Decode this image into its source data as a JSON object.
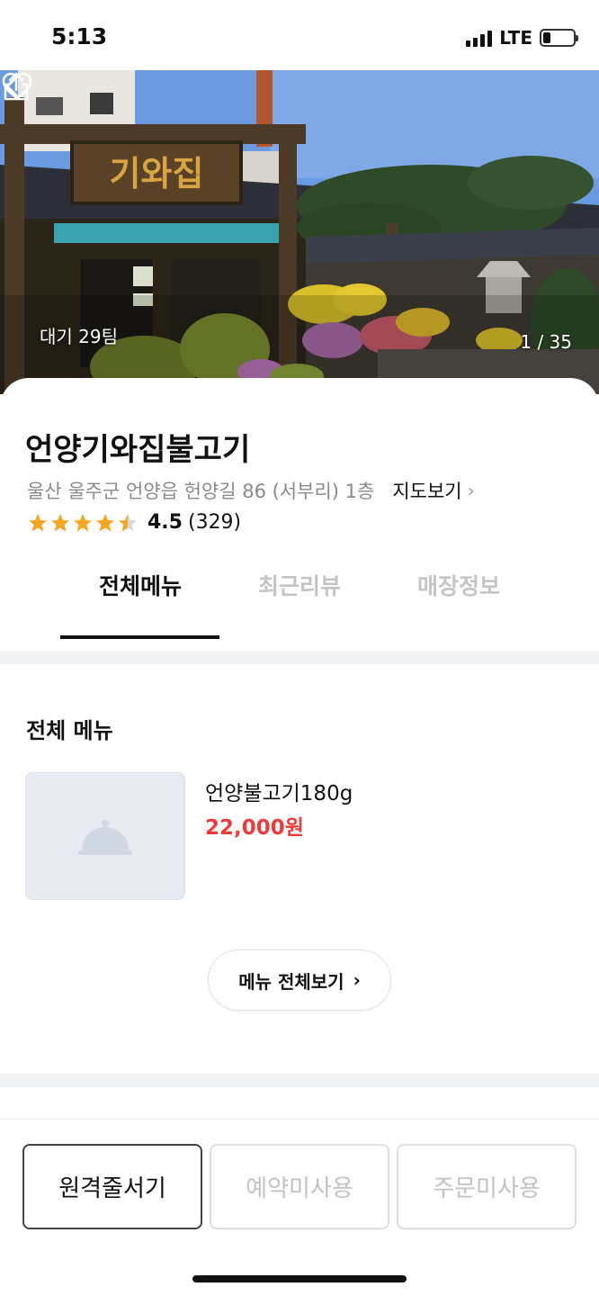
{
  "status_bar": {
    "time": "5:13",
    "network": "LTE"
  },
  "hero": {
    "sign_text": "기와집",
    "wait_label": "대기 29팀",
    "photo_counter": "1 / 35",
    "icons": {
      "back": "chevron-left-icon",
      "share": "share-icon",
      "like": "heart-icon"
    }
  },
  "store": {
    "name": "언양기와집불고기",
    "address": "울산 울주군 언양읍 헌양길 86 (서부리) 1층",
    "map_link": "지도보기",
    "rating": {
      "stars": 4.5,
      "score": "4.5",
      "count": "(329)"
    }
  },
  "tabs": [
    {
      "label": "전체메뉴",
      "active": true
    },
    {
      "label": "최근리뷰",
      "active": false
    },
    {
      "label": "매장정보",
      "active": false
    }
  ],
  "menu_section": {
    "title": "전체 메뉴",
    "items": [
      {
        "name": "언양불고기180g",
        "price": "22,000원"
      }
    ],
    "view_all": "메뉴 전체보기"
  },
  "bottom_actions": {
    "queue": "원격줄서기",
    "reserve": "예약미사용",
    "order": "주문미사용"
  },
  "colors": {
    "accent_price": "#ee3b3b",
    "star": "#f5a623",
    "inactive": "#c4c4c4"
  }
}
